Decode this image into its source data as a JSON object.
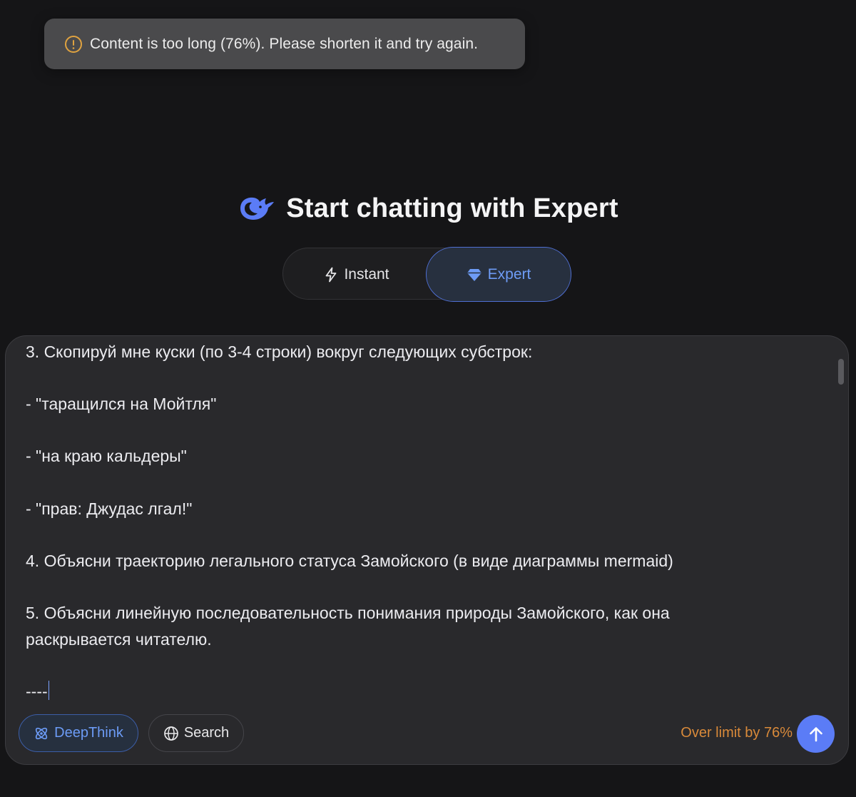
{
  "toast": {
    "icon": "warning-circle-icon",
    "message": "Content is too long (76%). Please shorten it and try again.",
    "accent": "#e0a340"
  },
  "heading": {
    "logo": "deepseek-whale-logo",
    "title": "Start chatting with Expert"
  },
  "mode_toggle": {
    "options": [
      {
        "label": "Instant",
        "icon": "lightning-icon",
        "selected": false
      },
      {
        "label": "Expert",
        "icon": "diamond-icon",
        "selected": true
      }
    ]
  },
  "composer": {
    "lines": [
      "3. Скопируй мне куски (по 3-4 строки) вокруг следующих субстрок:",
      "",
      "- \"таращился на Мойтля\"",
      "",
      "- \"на краю кальдеры\"",
      "",
      "- \"прав: Джудас лгал!\"",
      "",
      "4. Объясни траекторию легального статуса Замойского (в виде диаграммы mermaid)",
      "",
      "5. Объясни линейную последовательность понимания природы Замойского, как она",
      "раскрывается читателю.",
      "",
      "----"
    ],
    "deepthink_label": "DeepThink",
    "deepthink_icon": "atom-icon",
    "search_label": "Search",
    "search_icon": "globe-icon",
    "limit_text": "Over limit by 76%",
    "send_icon": "arrow-up-icon",
    "colors": {
      "accent": "#5b7cf6",
      "warning": "#d98a3a"
    }
  }
}
